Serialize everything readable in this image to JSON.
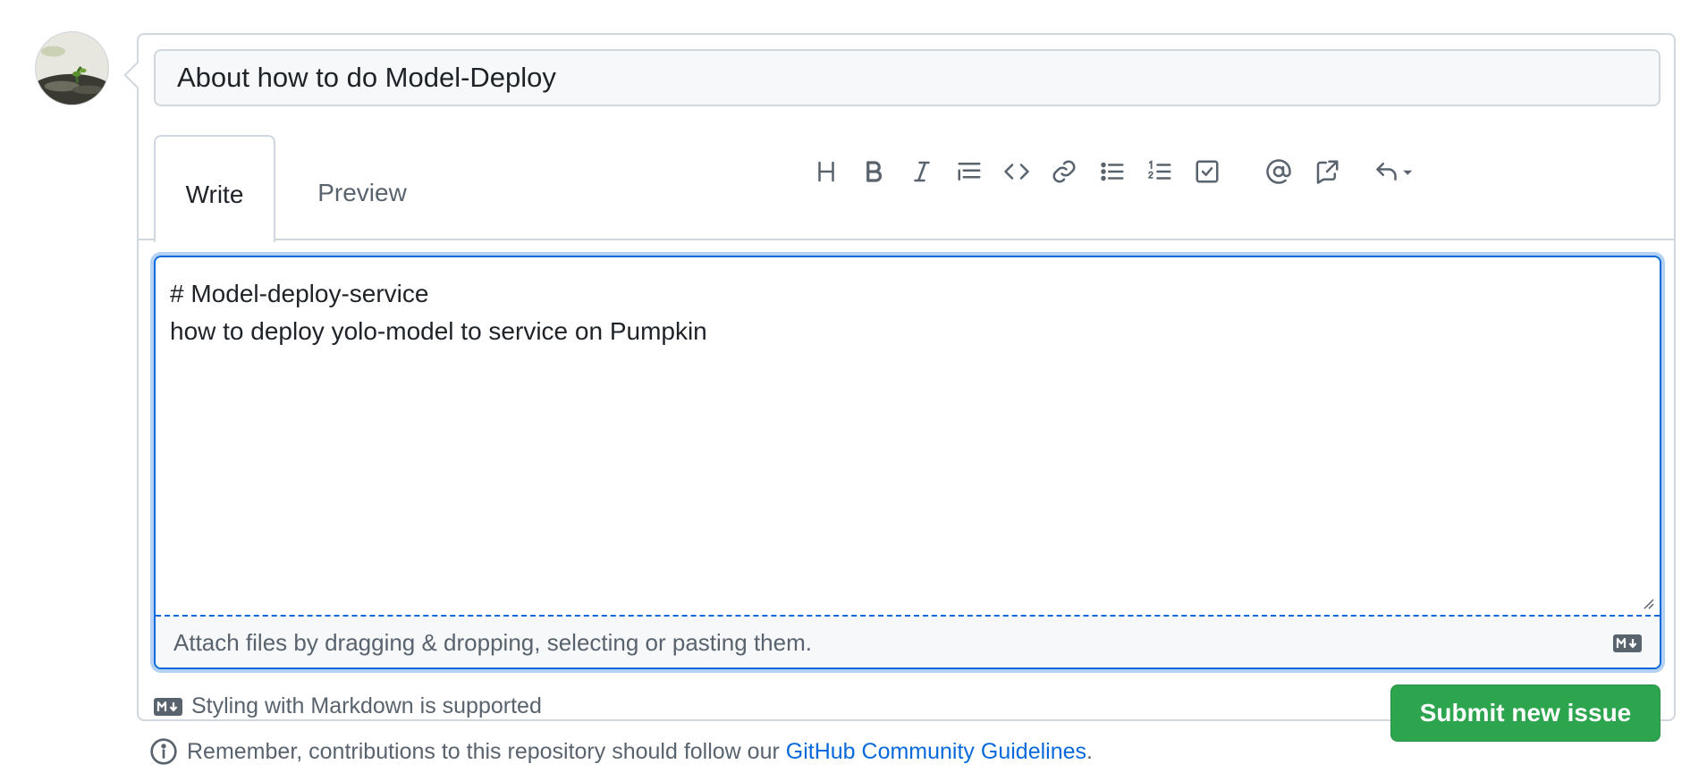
{
  "issue": {
    "title_value": "About how to do Model-Deploy"
  },
  "tabs": [
    {
      "label": "Write",
      "active": true
    },
    {
      "label": "Preview",
      "active": false
    }
  ],
  "toolbar": {
    "icons": [
      "heading-icon",
      "bold-icon",
      "italic-icon",
      "quote-icon",
      "code-icon",
      "link-icon",
      "bulleted-list-icon",
      "numbered-list-icon",
      "task-list-icon",
      "mention-icon",
      "cross-reference-icon",
      "saved-replies-icon"
    ]
  },
  "editor": {
    "body_value": "# Model-deploy-service\nhow to deploy yolo-model to service on Pumpkin",
    "attach_hint": "Attach files by dragging & dropping, selecting or pasting them."
  },
  "footer": {
    "markdown_note": "Styling with Markdown is supported",
    "submit_label": "Submit new issue"
  },
  "guidelines": {
    "prefix": "Remember, contributions to this repository should follow our ",
    "link_text": "GitHub Community Guidelines",
    "suffix": "."
  },
  "colors": {
    "accent": "#0969da",
    "submit": "#2da44e",
    "border": "#d0d7de"
  }
}
